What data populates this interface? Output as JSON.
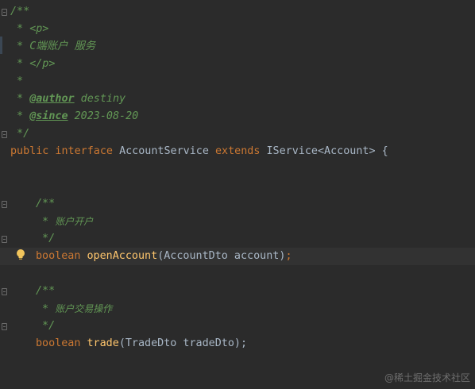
{
  "code": {
    "lines": {
      "l1": "/**",
      "l2_star": " * ",
      "l2_tag": "<p>",
      "l3_star": " * ",
      "l3_text": "C端账户 服务",
      "l4_star": " * ",
      "l4_tag": "</p>",
      "l5": " *",
      "l6_star": " * ",
      "l6_tag": "@author",
      "l6_text": " destiny",
      "l7_star": " * ",
      "l7_tag": "@since",
      "l7_text": " 2023-08-20",
      "l8": " */",
      "l9_kw1": "public interface ",
      "l9_name": "AccountService ",
      "l9_kw2": "extends ",
      "l9_rest": "IService<Account> {",
      "l12": "/**",
      "l13_star": " * ",
      "l13_text": "账户开户",
      "l14": " */",
      "l15_kw": "boolean ",
      "l15_method": "openAccount",
      "l15_rest": "(AccountDto account)",
      "l15_semi": ";",
      "l17": "/**",
      "l18_star": " * ",
      "l18_text": "账户交易操作",
      "l19": " */",
      "l20_kw": "boolean ",
      "l20_method": "trade",
      "l20_rest": "(TradeDto tradeDto);"
    }
  },
  "icons": {
    "bulb": "lightbulb-icon",
    "fold": "fold-icon"
  },
  "colors": {
    "background": "#2b2b2b",
    "doc_comment": "#629755",
    "keyword": "#cc7832",
    "plain": "#a9b7c6",
    "method": "#ffc66d",
    "bulb": "#f2c55c"
  },
  "watermark": "@稀土掘金技术社区"
}
